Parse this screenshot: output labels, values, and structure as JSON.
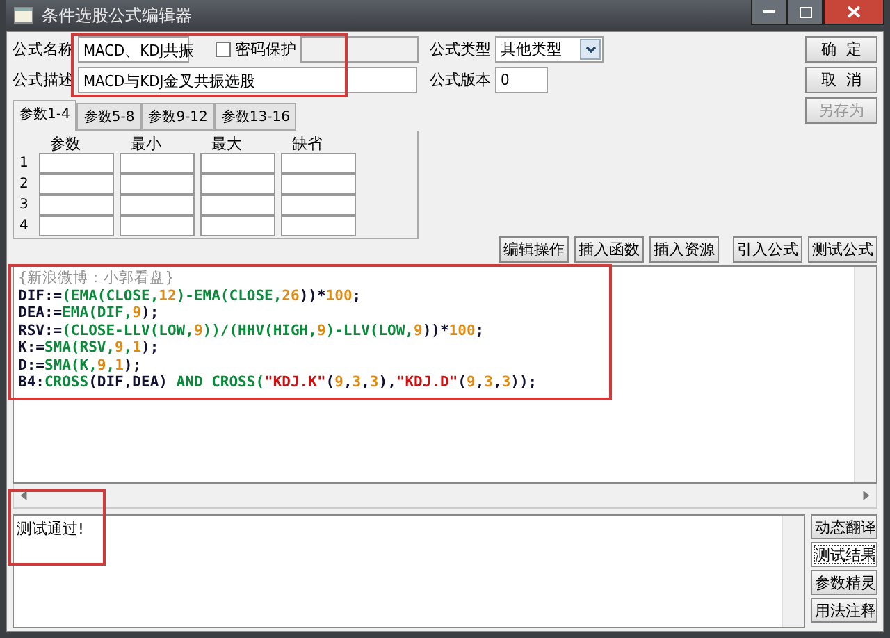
{
  "window": {
    "title": "条件选股公式编辑器"
  },
  "formula": {
    "name_label": "公式名称",
    "name": "MACD、KDJ共振",
    "password": {
      "label": "密码保护",
      "checked": false
    },
    "desc_label": "公式描述",
    "desc": "MACD与KDJ金叉共振选股",
    "type_label": "公式类型",
    "type": "其他类型",
    "version_label": "公式版本",
    "version": "0"
  },
  "dialog_buttons": [
    {
      "label": "确  定",
      "disabled": false
    },
    {
      "label": "取  消",
      "disabled": false
    },
    {
      "label": "另存为",
      "disabled": true
    }
  ],
  "param_tabs": [
    {
      "label": "参数1-4",
      "selected": true
    },
    {
      "label": "参数5-8",
      "selected": false
    },
    {
      "label": "参数9-12",
      "selected": false
    },
    {
      "label": "参数13-16",
      "selected": false
    }
  ],
  "param_table": {
    "columns": [
      "参数",
      "最小",
      "最大",
      "缺省"
    ],
    "rows": [
      "1",
      "2",
      "3",
      "4"
    ]
  },
  "toolbar_groups": [
    [
      "编辑操作",
      "插入函数",
      "插入资源"
    ],
    [
      "引入公式",
      "测试公式"
    ]
  ],
  "code_lines": [
    [
      {
        "text": "{新浪微博：小郭看盘}",
        "kind": "comment"
      }
    ],
    [
      {
        "text": "DIF:=",
        "kind": "plain"
      },
      {
        "text": "(EMA(CLOSE,",
        "kind": "func"
      },
      {
        "text": "12",
        "kind": "num"
      },
      {
        "text": ")-EMA(CLOSE,",
        "kind": "func"
      },
      {
        "text": "26",
        "kind": "num"
      },
      {
        "text": "))*",
        "kind": "plain"
      },
      {
        "text": "100",
        "kind": "num"
      },
      {
        "text": ";",
        "kind": "plain"
      }
    ],
    [
      {
        "text": "DEA:=",
        "kind": "plain"
      },
      {
        "text": "EMA(DIF,",
        "kind": "func"
      },
      {
        "text": "9",
        "kind": "num"
      },
      {
        "text": ");",
        "kind": "plain"
      }
    ],
    [
      {
        "text": "RSV:=",
        "kind": "plain"
      },
      {
        "text": "(CLOSE-LLV(LOW,",
        "kind": "func"
      },
      {
        "text": "9",
        "kind": "num"
      },
      {
        "text": "))/(HHV(HIGH,",
        "kind": "func"
      },
      {
        "text": "9",
        "kind": "num"
      },
      {
        "text": ")-LLV(LOW,",
        "kind": "func"
      },
      {
        "text": "9",
        "kind": "num"
      },
      {
        "text": "))*",
        "kind": "plain"
      },
      {
        "text": "100",
        "kind": "num"
      },
      {
        "text": ";",
        "kind": "plain"
      }
    ],
    [
      {
        "text": "K:=",
        "kind": "plain"
      },
      {
        "text": "SMA(RSV,",
        "kind": "func"
      },
      {
        "text": "9",
        "kind": "num"
      },
      {
        "text": ",",
        "kind": "func"
      },
      {
        "text": "1",
        "kind": "num"
      },
      {
        "text": ");",
        "kind": "plain"
      }
    ],
    [
      {
        "text": "D:=",
        "kind": "plain"
      },
      {
        "text": "SMA(K,",
        "kind": "func"
      },
      {
        "text": "9",
        "kind": "num"
      },
      {
        "text": ",",
        "kind": "func"
      },
      {
        "text": "1",
        "kind": "num"
      },
      {
        "text": ");",
        "kind": "plain"
      }
    ],
    [
      {
        "text": "B4:",
        "kind": "plain"
      },
      {
        "text": "CROSS",
        "kind": "func"
      },
      {
        "text": "(DIF,DEA) ",
        "kind": "plain"
      },
      {
        "text": "AND CROSS(",
        "kind": "func"
      },
      {
        "text": "\"KDJ.K\"",
        "kind": "str"
      },
      {
        "text": "(",
        "kind": "plain"
      },
      {
        "text": "9",
        "kind": "num"
      },
      {
        "text": ",",
        "kind": "plain"
      },
      {
        "text": "3",
        "kind": "num"
      },
      {
        "text": ",",
        "kind": "plain"
      },
      {
        "text": "3",
        "kind": "num"
      },
      {
        "text": "),",
        "kind": "plain"
      },
      {
        "text": "\"KDJ.D\"",
        "kind": "str"
      },
      {
        "text": "(",
        "kind": "plain"
      },
      {
        "text": "9",
        "kind": "num"
      },
      {
        "text": ",",
        "kind": "plain"
      },
      {
        "text": "3",
        "kind": "num"
      },
      {
        "text": ",",
        "kind": "plain"
      },
      {
        "text": "3",
        "kind": "num"
      },
      {
        "text": "));",
        "kind": "plain"
      }
    ]
  ],
  "output": {
    "text": "测试通过!"
  },
  "side_buttons": [
    {
      "label": "动态翻译",
      "selected": false
    },
    {
      "label": "测试结果",
      "selected": true
    },
    {
      "label": "参数精灵",
      "selected": false
    },
    {
      "label": "用法注释",
      "selected": false
    }
  ]
}
